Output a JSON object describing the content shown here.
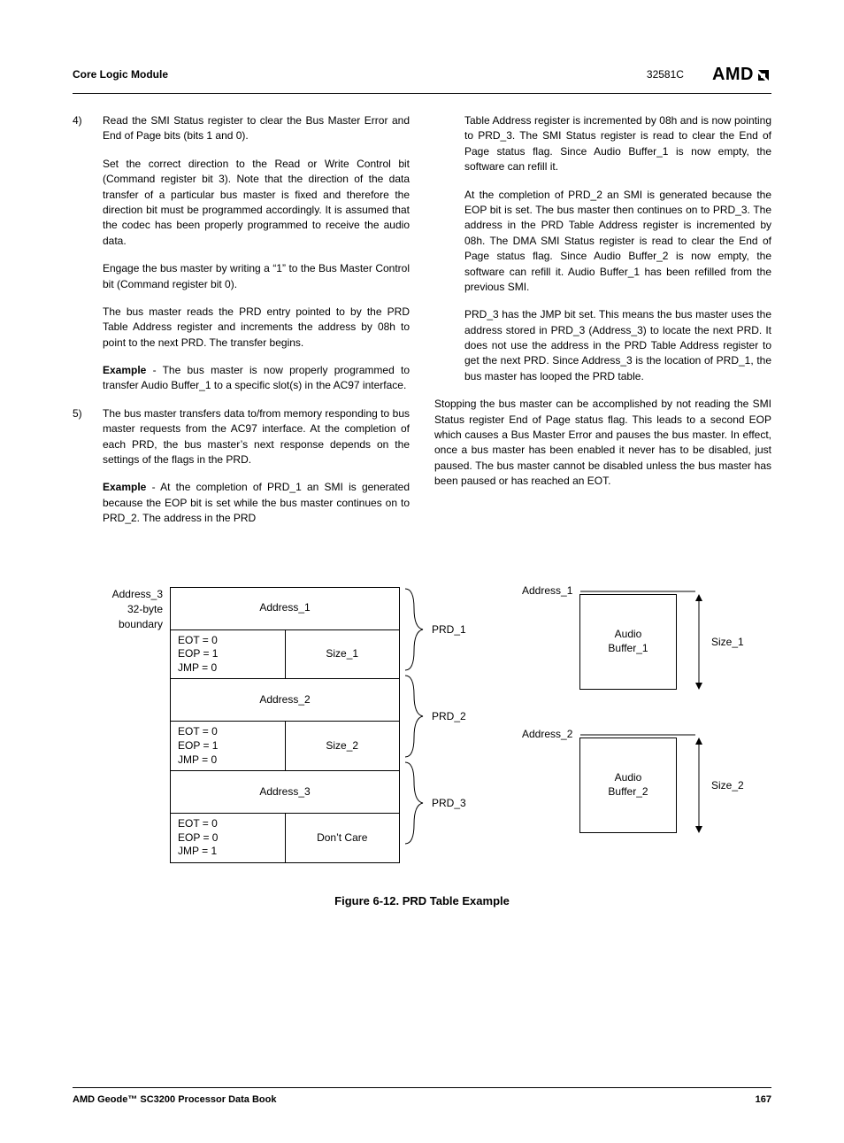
{
  "header": {
    "section": "Core Logic Module",
    "doc_code": "32581C",
    "logo_text": "AMD"
  },
  "body": {
    "item4": {
      "num": "4)",
      "p1": "Read the SMI Status register to clear the Bus Master Error and End of Page bits (bits 1 and 0).",
      "p2": "Set the correct direction to the Read or Write Control bit (Command register bit 3). Note that the direction of the data transfer of a particular bus master is fixed and therefore the direction bit must be programmed accordingly. It is assumed that the codec has been properly programmed to receive the audio data.",
      "p3": "Engage the bus master by writing a “1” to the Bus Master Control bit (Command register bit 0).",
      "p4": "The bus master reads the PRD entry pointed to by the PRD Table Address register and increments the address by 08h to point to the next PRD. The transfer begins.",
      "p5_label": "Example",
      "p5_rest": " - The bus master is now properly programmed to transfer Audio Buffer_1 to a specific slot(s) in the AC97 interface."
    },
    "item5": {
      "num": "5)",
      "p1": "The bus master transfers data to/from memory responding to bus master requests from the AC97 interface. At the completion of each PRD, the bus master’s next response depends on the settings of the flags in the PRD.",
      "p2_label": "Example",
      "p2_rest": " - At the completion of PRD_1 an SMI is generated because the EOP bit is set while the bus master continues on to PRD_2. The address in the PRD"
    },
    "col2": {
      "p1": "Table Address register is incremented by 08h and is now pointing to PRD_3. The SMI Status register is read to clear the End of Page status flag. Since Audio Buffer_1 is now empty, the software can refill it.",
      "p2": "At the completion of PRD_2 an SMI is generated because the EOP bit is set. The bus master then continues on to PRD_3. The address in the PRD Table Address register is incremented by 08h. The DMA SMI Status register is read to clear the End of Page status flag. Since Audio Buffer_2 is now empty, the software can refill it. Audio Buffer_1 has been refilled from the previous SMI.",
      "p3": "PRD_3 has the JMP bit set. This means the bus master uses the address stored in PRD_3 (Address_3) to locate the next PRD. It does not use the address in the PRD Table Address register to get the next PRD. Since Address_3 is the location of PRD_1, the bus master has looped the PRD table.",
      "p4": "Stopping the bus master can be accomplished by not reading the SMI Status register End of Page status flag. This leads to a second EOP which causes a Bus Master Error and pauses the bus master. In effect, once a bus master has been enabled it never has to be disabled, just paused. The bus master cannot be disabled unless the bus master has been paused or has reached an EOT."
    }
  },
  "figure": {
    "side_l1": "Address_3",
    "side_l2": "32-byte",
    "side_l3": "boundary",
    "rows": [
      {
        "addr": "Address_1"
      },
      {
        "flags": [
          "EOT = 0",
          "EOP = 1",
          "JMP = 0"
        ],
        "size": "Size_1"
      },
      {
        "addr": "Address_2"
      },
      {
        "flags": [
          "EOT = 0",
          "EOP = 1",
          "JMP = 0"
        ],
        "size": "Size_2"
      },
      {
        "addr": "Address_3"
      },
      {
        "flags": [
          "EOT = 0",
          "EOP = 0",
          "JMP = 1"
        ],
        "size": "Don’t Care"
      }
    ],
    "prd_labels": [
      "PRD_1",
      "PRD_2",
      "PRD_3"
    ],
    "addr1": "Address_1",
    "addr2": "Address_2",
    "buf1": "Audio\nBuffer_1",
    "buf2": "Audio\nBuffer_2",
    "size1": "Size_1",
    "size2": "Size_2",
    "caption": "Figure 6-12.  PRD Table Example"
  },
  "footer": {
    "left": "AMD Geode™ SC3200 Processor Data Book",
    "right": "167"
  }
}
